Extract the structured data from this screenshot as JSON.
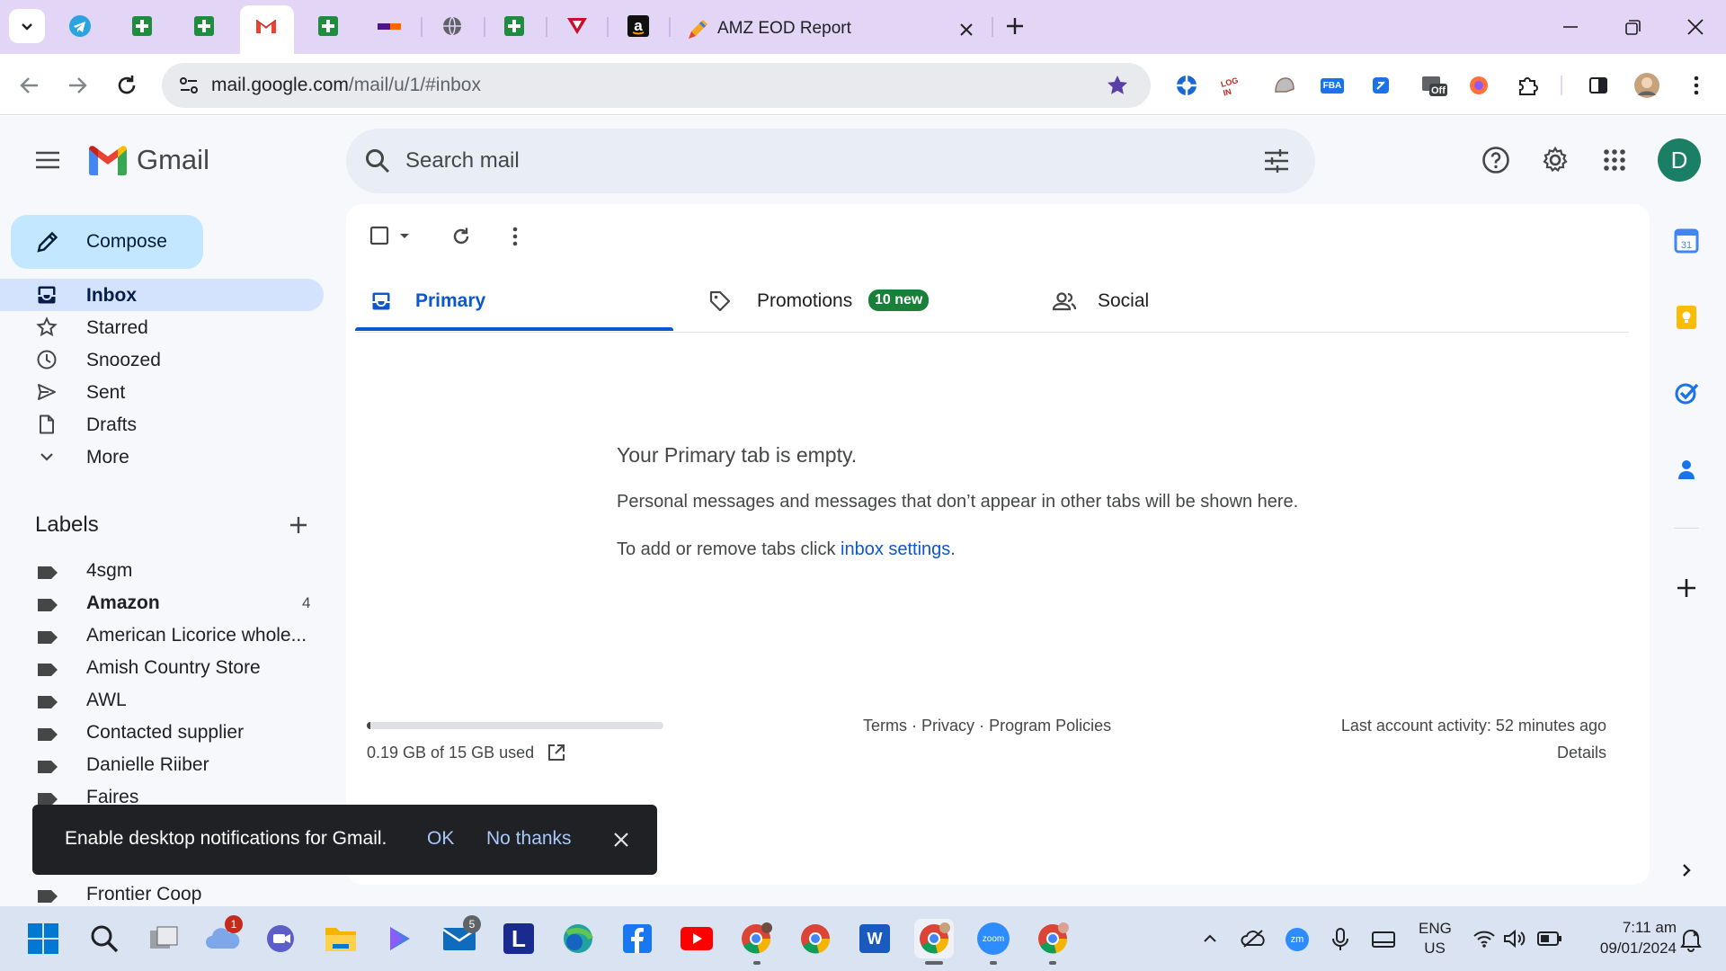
{
  "browser": {
    "active_tab_title": "AMZ EOD Report",
    "url_host": "mail.google.com",
    "url_path": "/mail/u/1/#inbox",
    "extension_labels": {
      "login": "LOG IN",
      "fba": "FBA",
      "off": "Off"
    }
  },
  "gmail": {
    "logo_text": "Gmail",
    "search_placeholder": "Search mail",
    "avatar_initial": "D",
    "compose_label": "Compose",
    "nav": [
      {
        "label": "Inbox",
        "icon": "inbox-icon"
      },
      {
        "label": "Starred",
        "icon": "star-icon"
      },
      {
        "label": "Snoozed",
        "icon": "clock-icon"
      },
      {
        "label": "Sent",
        "icon": "send-icon"
      },
      {
        "label": "Drafts",
        "icon": "draft-icon"
      },
      {
        "label": "More",
        "icon": "chevron-down-icon"
      }
    ],
    "labels_heading": "Labels",
    "labels": [
      {
        "name": "4sgm",
        "count": ""
      },
      {
        "name": "Amazon",
        "count": "4"
      },
      {
        "name": "American Licorice whole...",
        "count": ""
      },
      {
        "name": "Amish Country Store",
        "count": ""
      },
      {
        "name": "AWL",
        "count": ""
      },
      {
        "name": "Contacted supplier",
        "count": ""
      },
      {
        "name": "Danielle Riiber",
        "count": ""
      },
      {
        "name": "Faires",
        "count": ""
      },
      {
        "name": "Frontier Coop",
        "count": ""
      }
    ],
    "tabs": [
      {
        "label": "Primary",
        "badge": ""
      },
      {
        "label": "Promotions",
        "badge": "10 new"
      },
      {
        "label": "Social",
        "badge": ""
      }
    ],
    "empty": {
      "title": "Your Primary tab is empty.",
      "line1": "Personal messages and messages that don’t appear in other tabs will be shown here.",
      "line2_prefix": "To add or remove tabs click ",
      "line2_link": "inbox settings",
      "line2_suffix": "."
    },
    "footer": {
      "storage_text": "0.19 GB of 15 GB used",
      "storage_fraction": 0.013,
      "terms": "Terms",
      "privacy": "Privacy",
      "policies": "Program Policies",
      "sep": "·",
      "activity": "Last account activity: 52 minutes ago",
      "details": "Details"
    },
    "snackbar": {
      "message": "Enable desktop notifications for Gmail.",
      "ok": "OK",
      "no_thanks": "No thanks"
    }
  },
  "taskbar": {
    "weather_badge": "1",
    "mail_badge": "5",
    "l_letter": "L",
    "word_letter": "W",
    "zoom_label": "zoom",
    "zm_label": "zm",
    "lang": "ENG",
    "region": "US",
    "time": "7:11 am",
    "date": "09/01/2024"
  },
  "colors": {
    "accent_blue": "#0b57d0",
    "compose_bg": "#c2e7ff",
    "inbox_selected_bg": "#d3e3fd",
    "promotions_badge": "#188038",
    "avatar_bg": "#1a7f64",
    "chrome_frame": "#e3d5f5"
  }
}
